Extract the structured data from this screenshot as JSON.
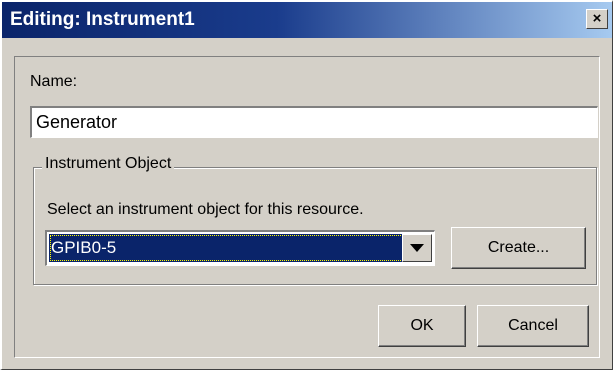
{
  "window": {
    "title": "Editing: Instrument1",
    "close_glyph": "×"
  },
  "form": {
    "name_label": "Name:",
    "name_value": "Generator"
  },
  "instrument_group": {
    "legend": "Instrument Object",
    "instruction": "Select an instrument object for this resource.",
    "selected_value": "GPIB0-5",
    "create_label": "Create..."
  },
  "footer": {
    "ok_label": "OK",
    "cancel_label": "Cancel"
  },
  "colors": {
    "titlebar_start": "#0a246a",
    "titlebar_end": "#a6caf0",
    "selection": "#0a246a",
    "dialog_face": "#d4d0c8"
  },
  "icons": {
    "close": "close-icon",
    "dropdown": "chevron-down-icon"
  }
}
